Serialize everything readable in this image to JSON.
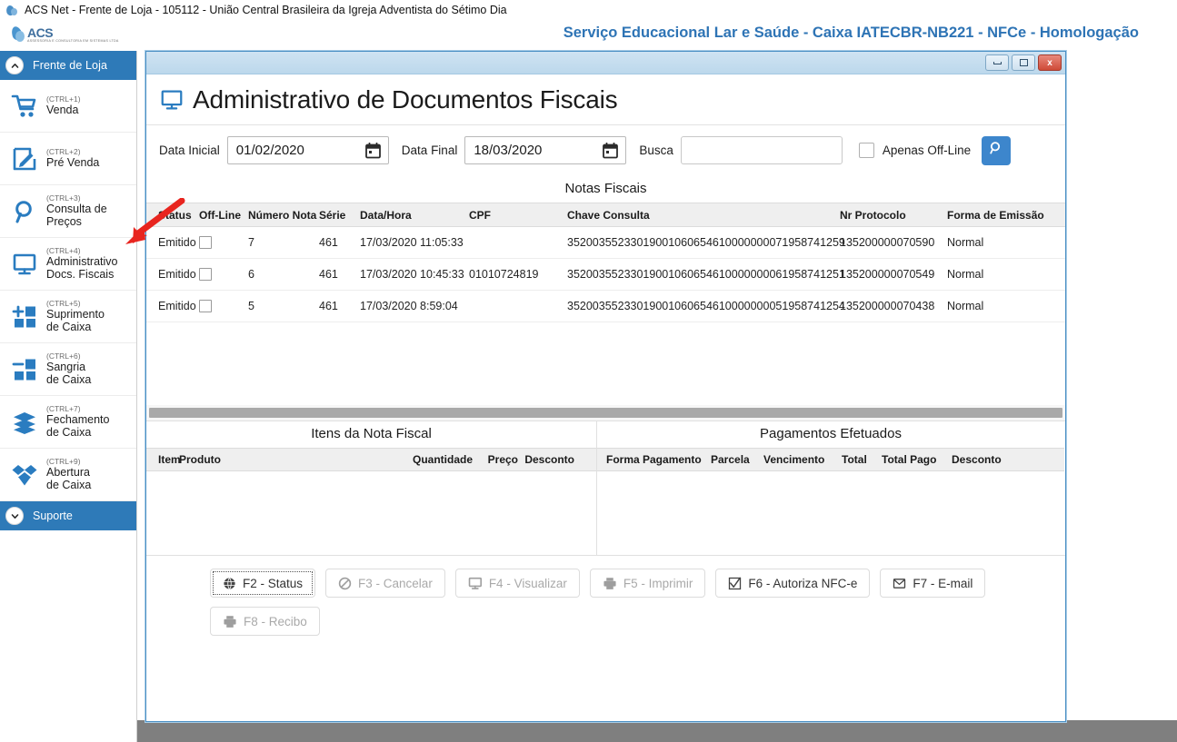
{
  "os": {
    "titlebar": "ACS Net - Frente de Loja - 105112 - União Central Brasileira da Igreja Adventista do Sétimo Dia",
    "app_icon": "acs-droplet-icon"
  },
  "brand": {
    "logo_text": "ACS",
    "logo_subtext": "ASSESSORIA E CONSULTORIA EM SISTEMAS LTDA",
    "title": "Serviço Educacional Lar e Saúde - Caixa IATECBR-NB221 - NFCe - Homologação",
    "title_color": "#2e74b5"
  },
  "sidebar": {
    "header": {
      "label": "Frente de Loja",
      "icon": "chevron-up-icon"
    },
    "footer": {
      "label": "Suporte",
      "icon": "chevron-down-icon"
    },
    "accent_color": "#2e7ab8",
    "items": [
      {
        "shortcut": "(CTRL+1)",
        "label": "Venda",
        "icon": "shopping-cart-icon"
      },
      {
        "shortcut": "(CTRL+2)",
        "label": "Pré Venda",
        "icon": "edit-pencil-icon"
      },
      {
        "shortcut": "(CTRL+3)",
        "label": "Consulta de\nPreços",
        "icon": "magnifier-icon"
      },
      {
        "shortcut": "(CTRL+4)",
        "label": "Administrativo\nDocs. Fiscais",
        "icon": "monitor-icon"
      },
      {
        "shortcut": "(CTRL+5)",
        "label": "Suprimento\nde Caixa",
        "icon": "add-blocks-icon"
      },
      {
        "shortcut": "(CTRL+6)",
        "label": "Sangria\nde Caixa",
        "icon": "minus-blocks-icon"
      },
      {
        "shortcut": "(CTRL+7)",
        "label": "Fechamento\nde Caixa",
        "icon": "stack-layers-icon"
      },
      {
        "shortcut": "(CTRL+9)",
        "label": "Abertura\nde Caixa",
        "icon": "open-box-icon"
      }
    ]
  },
  "window": {
    "controls": {
      "minimize": "–",
      "maximize": "□",
      "close": "x"
    }
  },
  "page": {
    "title": "Administrativo de Documentos Fiscais",
    "title_icon": "monitor-icon"
  },
  "filters": {
    "data_inicial_label": "Data Inicial",
    "data_inicial_value": "01/02/2020",
    "data_final_label": "Data Final",
    "data_final_value": "18/03/2020",
    "busca_label": "Busca",
    "busca_value": "",
    "busca_placeholder": "",
    "apenas_offline_label": "Apenas Off-Line",
    "apenas_offline_checked": false,
    "search_button_icon": "magnifier-icon",
    "search_button_color": "#3d86cc",
    "calendar_icon": "calendar-icon"
  },
  "notas": {
    "caption": "Notas Fiscais",
    "columns": [
      "Status",
      "Off-Line",
      "Número Nota",
      "Série",
      "Data/Hora",
      "CPF",
      "Chave Consulta",
      "Nr Protocolo",
      "Forma de Emissão"
    ],
    "rows": [
      {
        "status": "Emitido",
        "offline": false,
        "numero": "7",
        "serie": "461",
        "datahora": "17/03/2020 11:05:33",
        "cpf": "",
        "chave": "35200355233019001060654610000000071958741259",
        "protocolo": "135200000070590",
        "forma": "Normal"
      },
      {
        "status": "Emitido",
        "offline": false,
        "numero": "6",
        "serie": "461",
        "datahora": "17/03/2020 10:45:33",
        "cpf": "01010724819",
        "chave": "35200355233019001060654610000000061958741251",
        "protocolo": "135200000070549",
        "forma": "Normal"
      },
      {
        "status": "Emitido",
        "offline": false,
        "numero": "5",
        "serie": "461",
        "datahora": "17/03/2020 8:59:04",
        "cpf": "",
        "chave": "35200355233019001060654610000000051958741254",
        "protocolo": "135200000070438",
        "forma": "Normal"
      }
    ]
  },
  "itens_panel": {
    "caption": "Itens da Nota Fiscal",
    "columns": [
      "Item",
      "Produto",
      "Quantidade",
      "Preço",
      "Desconto"
    ],
    "rows": []
  },
  "pagamentos_panel": {
    "caption": "Pagamentos Efetuados",
    "columns": [
      "Forma Pagamento",
      "Parcela",
      "Vencimento",
      "Total",
      "Total Pago",
      "Desconto"
    ],
    "rows": []
  },
  "actions": {
    "row1": [
      {
        "label": "F2 - Status",
        "icon": "globe-icon",
        "disabled": false,
        "focused": true
      },
      {
        "label": "F3 - Cancelar",
        "icon": "no-entry-icon",
        "disabled": true,
        "focused": false
      },
      {
        "label": "F4 - Visualizar",
        "icon": "monitor-icon",
        "disabled": true,
        "focused": false
      },
      {
        "label": "F5 - Imprimir",
        "icon": "printer-icon",
        "disabled": true,
        "focused": false
      },
      {
        "label": "F6 - Autoriza NFC-e",
        "icon": "checkbox-icon",
        "disabled": false,
        "focused": false
      },
      {
        "label": "F7 - E-mail",
        "icon": "envelope-icon",
        "disabled": false,
        "focused": false
      }
    ],
    "row2": [
      {
        "label": "F8 - Recibo",
        "icon": "printer-icon",
        "disabled": true,
        "focused": false
      }
    ]
  },
  "annotation": {
    "arrow": "red-arrow-pointing-to-administrativo-docs-fiscais",
    "color": "#e8251f"
  }
}
